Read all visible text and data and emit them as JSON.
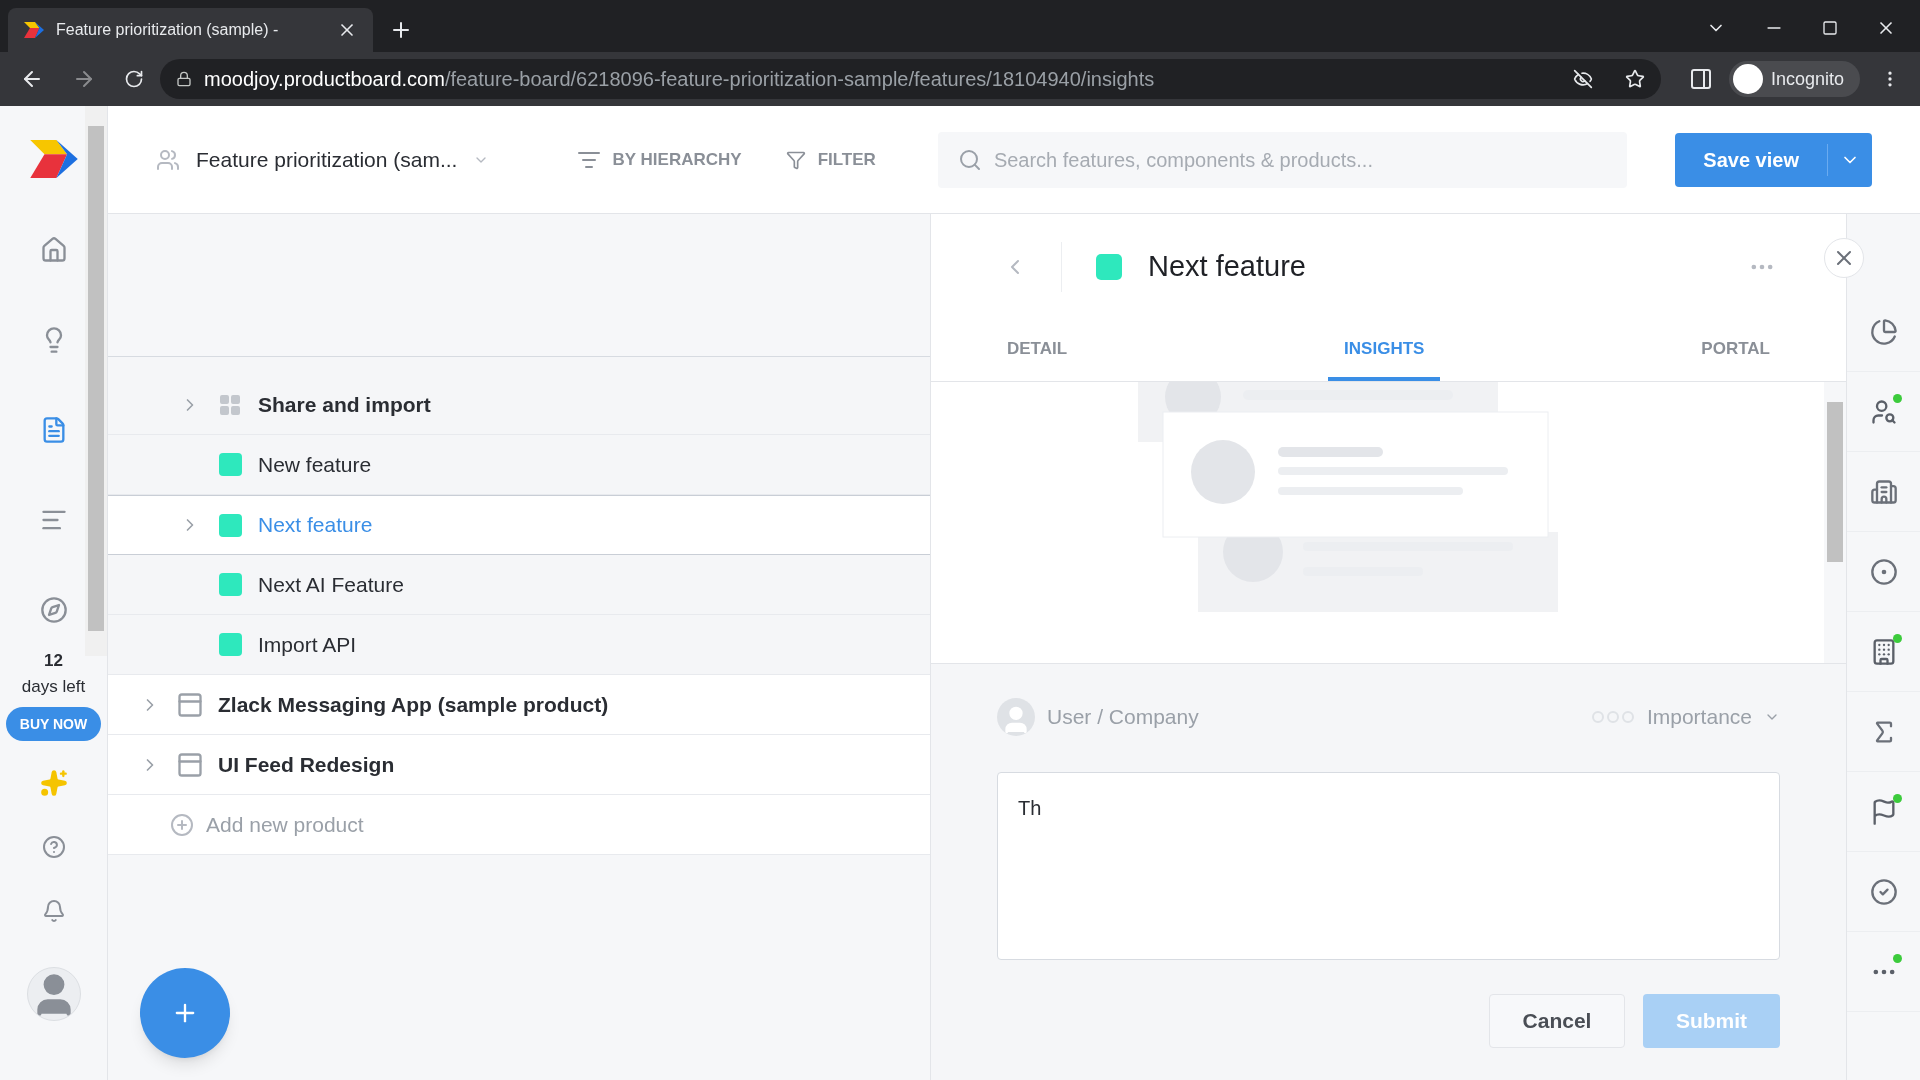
{
  "browser": {
    "tab_title": "Feature prioritization (sample) -",
    "url_host": "moodjoy.productboard.com",
    "url_path": "/feature-board/6218096-feature-prioritization-sample/features/18104940/insights",
    "profile": "Incognito"
  },
  "nav": {
    "items": [
      {
        "kind": "home",
        "selected": false
      },
      {
        "kind": "insights",
        "selected": false
      },
      {
        "kind": "features",
        "selected": true
      },
      {
        "kind": "roadmap",
        "selected": false
      },
      {
        "kind": "portal",
        "selected": false
      }
    ],
    "trial_days": "12",
    "trial_label": "days left",
    "buy_button": "BUY NOW"
  },
  "toolbar": {
    "board": "Feature prioritization (sam...",
    "group_by": "BY HIERARCHY",
    "filter": "FILTER",
    "search_placeholder": "Search features, components & products...",
    "save_button": "Save view"
  },
  "tree": [
    {
      "kind": "component",
      "label": "Share and import",
      "expandable": true,
      "selected": false
    },
    {
      "kind": "feature",
      "label": "New feature",
      "expandable": false,
      "selected": false
    },
    {
      "kind": "feature",
      "label": "Next feature",
      "expandable": true,
      "selected": true
    },
    {
      "kind": "feature",
      "label": "Next AI Feature",
      "expandable": false,
      "selected": false
    },
    {
      "kind": "feature",
      "label": "Import API",
      "expandable": false,
      "selected": false
    },
    {
      "kind": "product",
      "label": "Zlack Messaging App (sample product)",
      "expandable": true,
      "selected": false
    },
    {
      "kind": "product",
      "label": "UI Feed Redesign",
      "expandable": true,
      "selected": false
    },
    {
      "kind": "add",
      "label": "Add new product",
      "expandable": false,
      "selected": false
    }
  ],
  "detail": {
    "title": "Next feature",
    "color": "#2ee8bd",
    "tabs": [
      {
        "label": "DETAIL",
        "selected": false
      },
      {
        "label": "INSIGHTS",
        "selected": true
      },
      {
        "label": "PORTAL",
        "selected": false
      }
    ],
    "form": {
      "user_placeholder": "User / Company",
      "importance": "Importance",
      "note_value": "Th",
      "cancel": "Cancel",
      "submit": "Submit",
      "submit_disabled": true
    }
  },
  "rail": [
    {
      "kind": "pie",
      "dot": false
    },
    {
      "kind": "user",
      "dot": true
    },
    {
      "kind": "company",
      "dot": false
    },
    {
      "kind": "target",
      "dot": false
    },
    {
      "kind": "table",
      "dot": true
    },
    {
      "kind": "sum",
      "dot": false
    },
    {
      "kind": "flag",
      "dot": true
    },
    {
      "kind": "check",
      "dot": false
    },
    {
      "kind": "more",
      "dot": true
    }
  ]
}
